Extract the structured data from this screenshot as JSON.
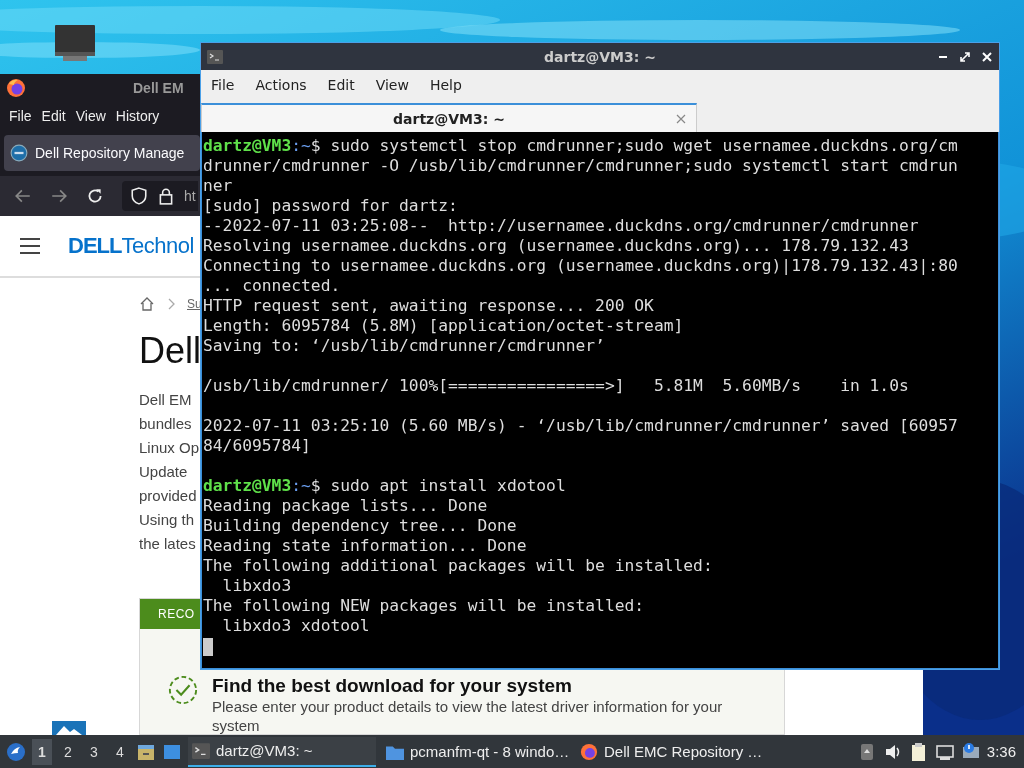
{
  "browser": {
    "title": "Dell EM",
    "menu": [
      "File",
      "Edit",
      "View",
      "History"
    ],
    "tab": {
      "title": "Dell Repository Manage",
      "selected": true
    },
    "url": "ht",
    "logo": {
      "brand": "DELL",
      "text": "Technol"
    },
    "breadcrumb": "Su",
    "heading": "Dell",
    "paragraph_lines": [
      "Dell EM",
      "bundles",
      "Linux Op",
      "Update",
      "provided",
      "Using th",
      "the lates"
    ],
    "card": {
      "label": "RECO",
      "title": "Find the best download for your system",
      "text": "Please enter your product details to view the latest driver information for your system"
    }
  },
  "terminal": {
    "title": "dartz@VM3: ~",
    "menu": [
      "File",
      "Actions",
      "Edit",
      "View",
      "Help"
    ],
    "tabs": [
      {
        "title": "dartz@VM3: ~",
        "selected": true
      }
    ],
    "lines": [
      {
        "kind": "prompt",
        "user": "dartz@VM3",
        "path": ":~",
        "text": "$ sudo systemctl stop cmdrunner;sudo wget usernamee.duckdns.org/cm"
      },
      {
        "kind": "output",
        "text": "drunner/cmdrunner -O /usb/lib/cmdrunner/cmdrunner;sudo systemctl start cmdrun"
      },
      {
        "kind": "output",
        "text": "ner"
      },
      {
        "kind": "output",
        "text": "[sudo] password for dartz:"
      },
      {
        "kind": "output",
        "text": "--2022-07-11 03:25:08--  http://usernamee.duckdns.org/cmdrunner/cmdrunner"
      },
      {
        "kind": "output",
        "text": "Resolving usernamee.duckdns.org (usernamee.duckdns.org)... 178.79.132.43"
      },
      {
        "kind": "output",
        "text": "Connecting to usernamee.duckdns.org (usernamee.duckdns.org)|178.79.132.43|:80"
      },
      {
        "kind": "output",
        "text": "... connected."
      },
      {
        "kind": "output",
        "text": "HTTP request sent, awaiting response... 200 OK"
      },
      {
        "kind": "output",
        "text": "Length: 6095784 (5.8M) [application/octet-stream]"
      },
      {
        "kind": "output",
        "text": "Saving to: ‘/usb/lib/cmdrunner/cmdrunner’"
      },
      {
        "kind": "blank"
      },
      {
        "kind": "output",
        "text": "/usb/lib/cmdrunner/ 100%[================>]   5.81M  5.60MB/s    in 1.0s"
      },
      {
        "kind": "blank"
      },
      {
        "kind": "output",
        "text": "2022-07-11 03:25:10 (5.60 MB/s) - ‘/usb/lib/cmdrunner/cmdrunner’ saved [60957"
      },
      {
        "kind": "output",
        "text": "84/6095784]"
      },
      {
        "kind": "blank"
      },
      {
        "kind": "prompt",
        "user": "dartz@VM3",
        "path": ":~",
        "text": "$ sudo apt install xdotool"
      },
      {
        "kind": "output",
        "text": "Reading package lists... Done"
      },
      {
        "kind": "output",
        "text": "Building dependency tree... Done"
      },
      {
        "kind": "output",
        "text": "Reading state information... Done"
      },
      {
        "kind": "output",
        "text": "The following additional packages will be installed:"
      },
      {
        "kind": "output",
        "text": "  libxdo3"
      },
      {
        "kind": "output",
        "text": "The following NEW packages will be installed:"
      },
      {
        "kind": "output",
        "text": "  libxdo3 xdotool"
      },
      {
        "kind": "cursor"
      }
    ]
  },
  "taskbar": {
    "workspaces": [
      {
        "label": "1",
        "selected": true
      },
      {
        "label": "2",
        "selected": false
      },
      {
        "label": "3",
        "selected": false
      },
      {
        "label": "4",
        "selected": false
      }
    ],
    "tasks": [
      {
        "kind": "terminal",
        "label": "dartz@VM3: ~",
        "selected": true
      },
      {
        "kind": "folder",
        "label": "pcmanfm-qt - 8 windo…",
        "selected": false
      },
      {
        "kind": "browser",
        "label": "Dell EMC Repository …",
        "selected": false
      }
    ],
    "clock": "3:36"
  }
}
